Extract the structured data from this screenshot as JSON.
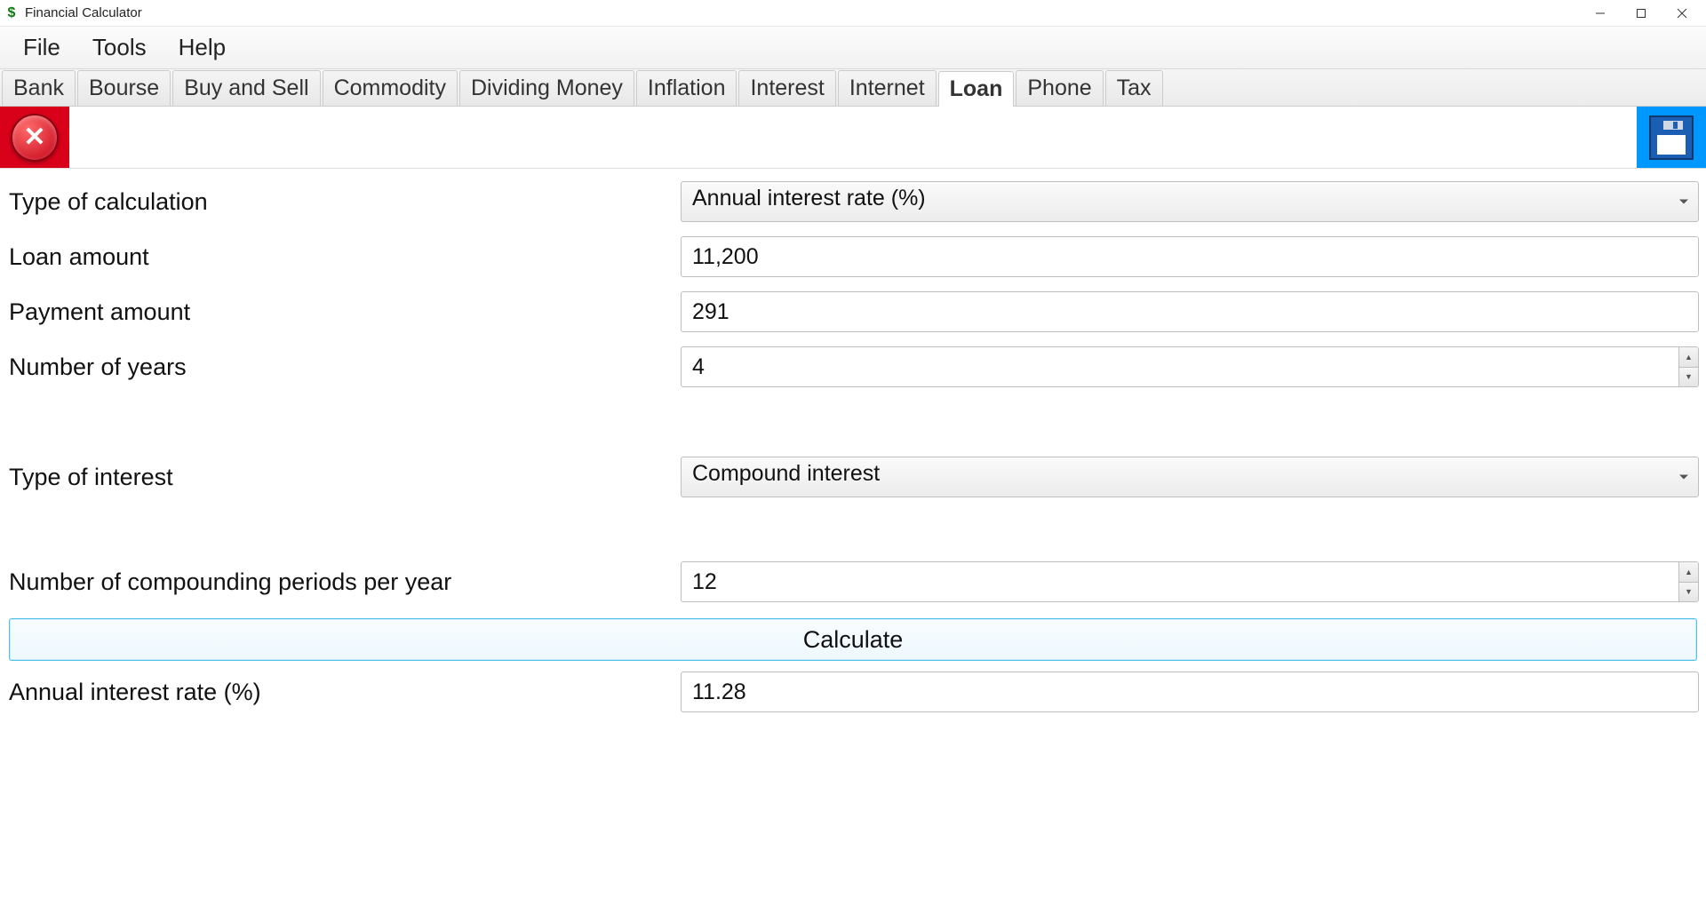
{
  "window": {
    "title": "Financial Calculator"
  },
  "menubar": {
    "items": [
      "File",
      "Tools",
      "Help"
    ]
  },
  "tabs": {
    "items": [
      "Bank",
      "Bourse",
      "Buy and Sell",
      "Commodity",
      "Dividing Money",
      "Inflation",
      "Interest",
      "Internet",
      "Loan",
      "Phone",
      "Tax"
    ],
    "active": "Loan"
  },
  "form": {
    "type_of_calculation": {
      "label": "Type of calculation",
      "value": "Annual interest rate (%)"
    },
    "loan_amount": {
      "label": "Loan amount",
      "value": "11,200"
    },
    "payment_amount": {
      "label": "Payment amount",
      "value": "291"
    },
    "number_of_years": {
      "label": "Number of years",
      "value": "4"
    },
    "type_of_interest": {
      "label": "Type of interest",
      "value": "Compound interest"
    },
    "compounding_periods": {
      "label": "Number of compounding periods per year",
      "value": "12"
    },
    "calculate_label": "Calculate",
    "result": {
      "label": "Annual interest rate (%)",
      "value": "11.28"
    }
  }
}
